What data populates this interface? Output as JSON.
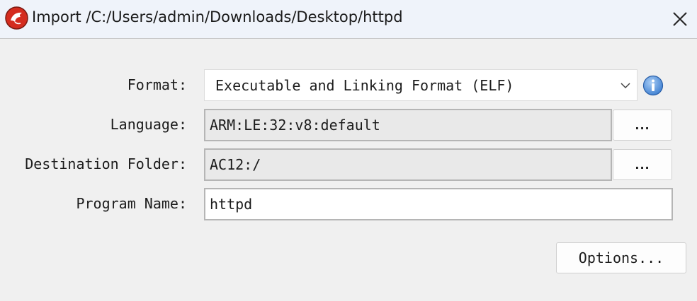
{
  "window": {
    "title": "Import /C:/Users/admin/Downloads/Desktop/httpd",
    "icon": "ghidra-dragon-icon"
  },
  "form": {
    "format_label": "Format:",
    "format_value": "Executable and Linking Format (ELF)",
    "language_label": "Language:",
    "language_value": "ARM:LE:32:v8:default",
    "language_browse": "...",
    "destination_label": "Destination Folder:",
    "destination_value": "AC12:/",
    "destination_browse": "...",
    "program_name_label": "Program Name:",
    "program_name_value": "httpd"
  },
  "buttons": {
    "options": "Options..."
  },
  "colors": {
    "titlebar_bg": "#eff3fa",
    "dialog_bg": "#f0f0f0",
    "readonly_bg": "#e9e9e9",
    "info_blue": "#3d7fd1",
    "icon_red": "#d42c1f"
  }
}
